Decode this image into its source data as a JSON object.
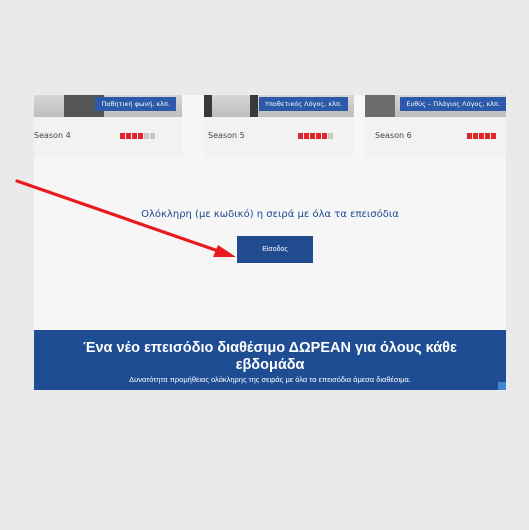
{
  "seasons": [
    {
      "tag": "Παθητική φωνή, κλπ.",
      "label": "Season 4",
      "rating": 4,
      "max": 6
    },
    {
      "tag": "Υποθετικός Λόγος, κλπ.",
      "label": "Season 5",
      "rating": 5,
      "max": 6
    },
    {
      "tag": "Ευθύς – Πλάγιος Λόγος, κλπ.",
      "label": "Season 6",
      "rating": 5,
      "max": 5
    }
  ],
  "headline": "Ολόκληρη (με κωδικό) η σειρά με όλα τα επεισόδια",
  "login_button": "Είσοδος",
  "banner": {
    "title_line1": "Ένα νέο επεισόδιο διαθέσιμο ΔΩΡΕΑΝ για όλους κάθε",
    "title_line2": "εβδομάδα",
    "subtitle": "Δυνατότητα προμήθειας ολόκληρης της σειράς με όλα τα επεισόδια άμεσα διαθέσιμα."
  },
  "colors": {
    "brand_blue": "#1f4d93",
    "rating_red": "#e0262b",
    "arrow_red": "#e8191f"
  }
}
